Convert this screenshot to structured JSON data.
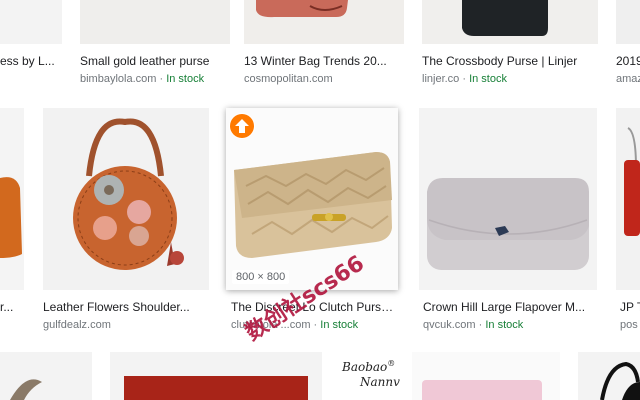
{
  "row1": [
    {
      "title": "ess by L...",
      "source": "",
      "stock": ""
    },
    {
      "title": "Small gold leather purse",
      "source": "bimbaylola.com",
      "stock": "In stock"
    },
    {
      "title": "13 Winter Bag Trends 20...",
      "source": "cosmopolitan.com",
      "stock": ""
    },
    {
      "title": "The Crossbody Purse | Linjer",
      "source": "linjer.co",
      "stock": "In stock"
    },
    {
      "title": "2019",
      "source": "amaz",
      "stock": ""
    }
  ],
  "row2": [
    {
      "title": "r...",
      "source": "",
      "stock": ""
    },
    {
      "title": "Leather Flowers Shoulder...",
      "source": "gulfdealz.com",
      "stock": ""
    },
    {
      "title": "The Discreet Lo  Clutch Purse...",
      "source": "clutchtola  ...com",
      "stock": "In stock",
      "dimensions": "800 × 800"
    },
    {
      "title": "Crown Hill Large Flapover M...",
      "source": "qvcuk.com",
      "stock": "In stock"
    },
    {
      "title": "JP T",
      "source": "pos",
      "stock": ""
    }
  ],
  "row3": {
    "baobao_logo_line1": "Baobao",
    "baobao_logo_line2": "Nannv",
    "baobao_logo_mark": "®"
  },
  "watermark": "数创社scs66",
  "colors": {
    "stock_green": "#188038",
    "source_grey": "#70757a",
    "orange_arrow": "#ff7a00"
  },
  "icons": {
    "selected_badge": "arrow-up-icon"
  }
}
